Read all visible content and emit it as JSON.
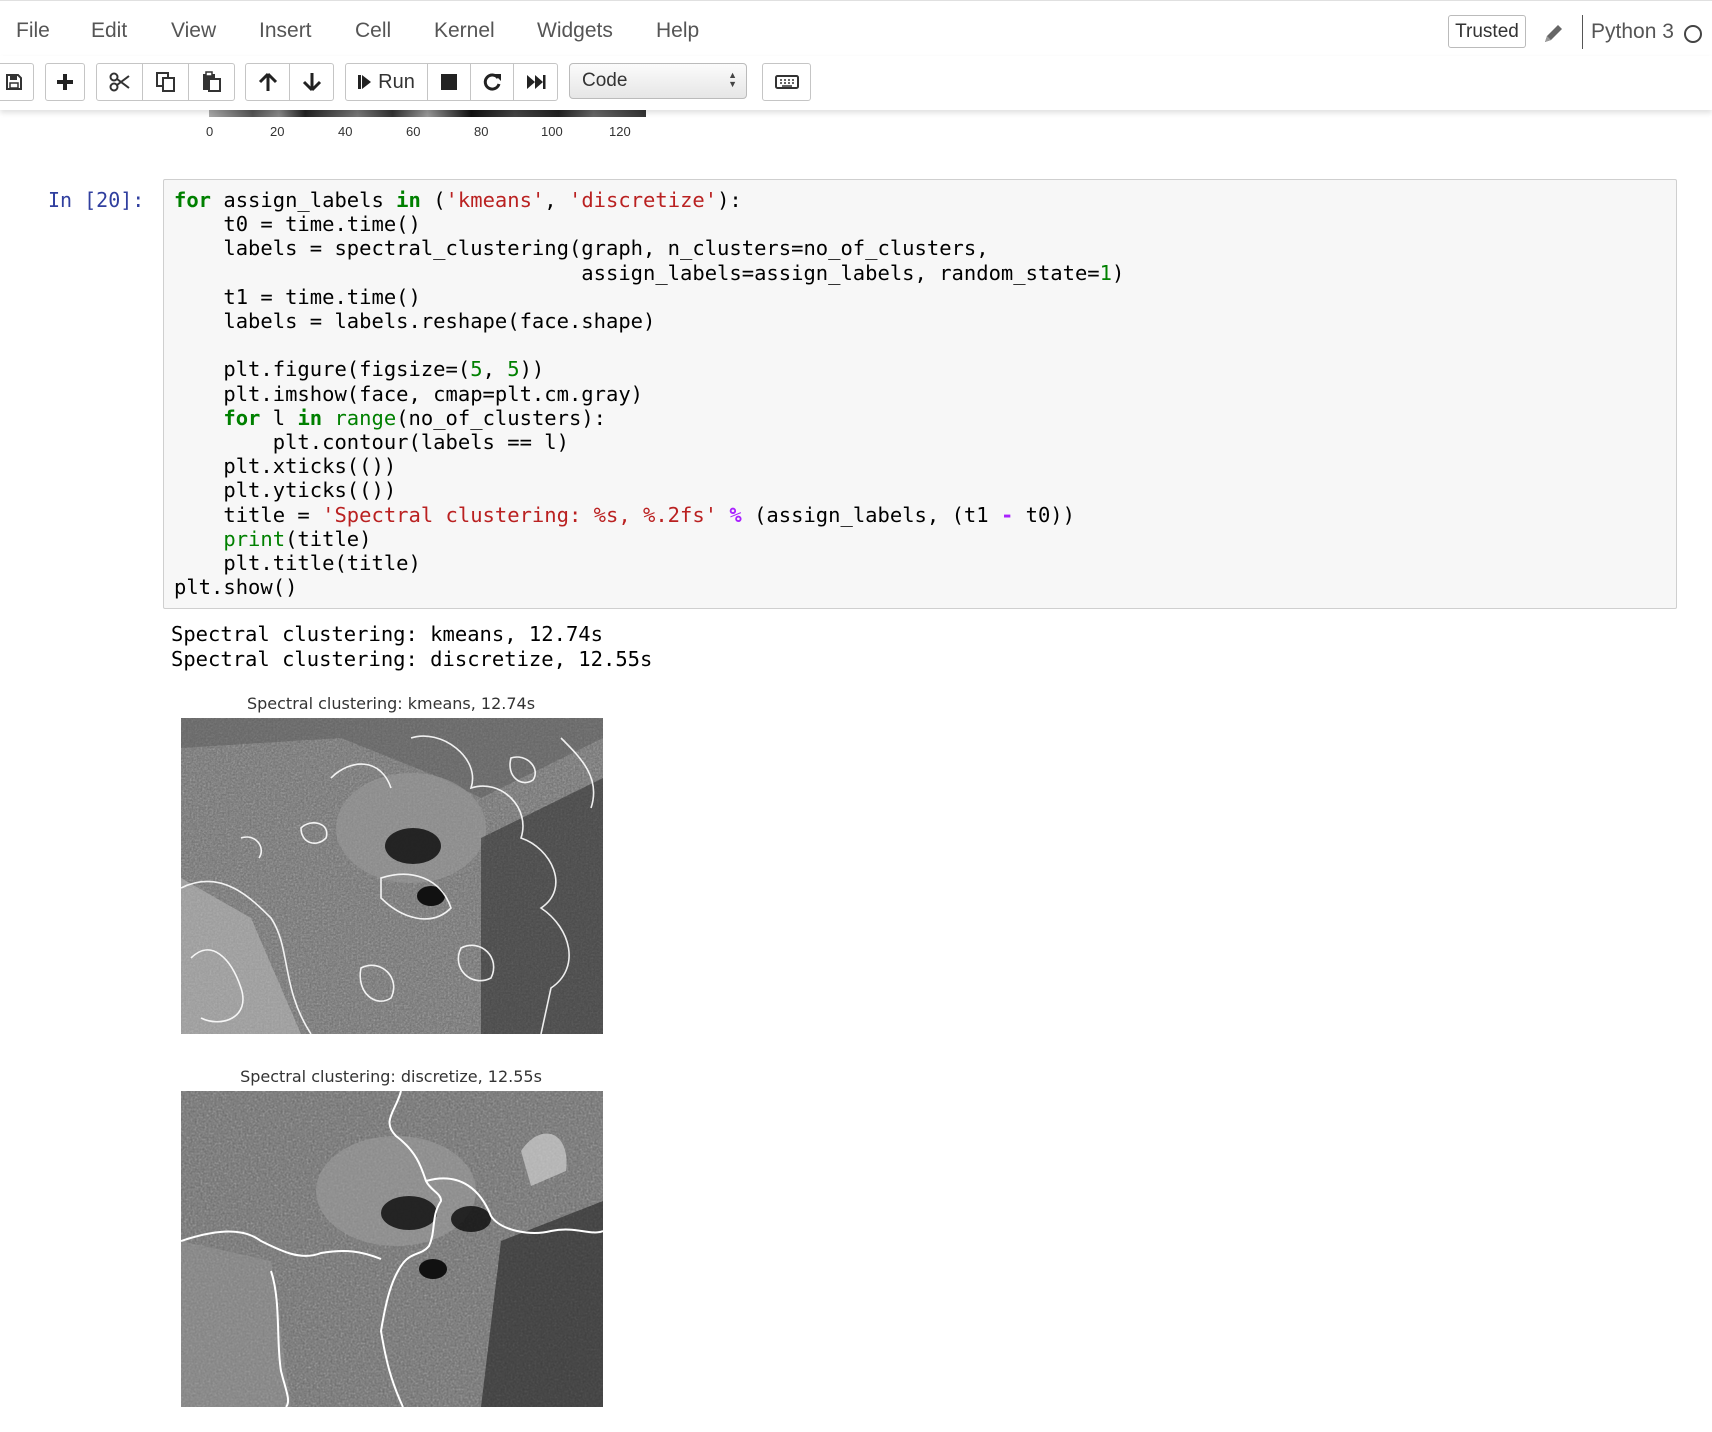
{
  "menubar": {
    "items": [
      "File",
      "Edit",
      "View",
      "Insert",
      "Cell",
      "Kernel",
      "Widgets",
      "Help"
    ],
    "trusted_label": "Trusted",
    "kernel_name": "Python 3"
  },
  "toolbar": {
    "run_label": "Run",
    "cell_type": "Code",
    "icons": [
      "save-icon",
      "plus-icon",
      "cut-icon",
      "copy-icon",
      "paste-icon",
      "arrow-up-icon",
      "arrow-down-icon",
      "step-forward-icon",
      "stop-icon",
      "restart-icon",
      "fast-forward-icon",
      "keyboard-icon"
    ]
  },
  "previous_output": {
    "x_ticks": [
      "0",
      "20",
      "40",
      "60",
      "80",
      "100",
      "120"
    ]
  },
  "cell": {
    "prompt": "In [20]:",
    "code": "for assign_labels in ('kmeans', 'discretize'):\n    t0 = time.time()\n    labels = spectral_clustering(graph, n_clusters=no_of_clusters,\n                                 assign_labels=assign_labels, random_state=1)\n    t1 = time.time()\n    labels = labels.reshape(face.shape)\n\n    plt.figure(figsize=(5, 5))\n    plt.imshow(face, cmap=plt.cm.gray)\n    for l in range(no_of_clusters):\n        plt.contour(labels == l)\n    plt.xticks(())\n    plt.yticks(())\n    title = 'Spectral clustering: %s, %.2fs' % (assign_labels, (t1 - t0))\n    print(title)\n    plt.title(title)\nplt.show()",
    "stdout": [
      "Spectral clustering: kmeans, 12.74s",
      "Spectral clustering: discretize, 12.55s"
    ],
    "figures": [
      {
        "title": "Spectral clustering: kmeans, 12.74s"
      },
      {
        "title": "Spectral clustering: discretize, 12.55s"
      }
    ]
  }
}
